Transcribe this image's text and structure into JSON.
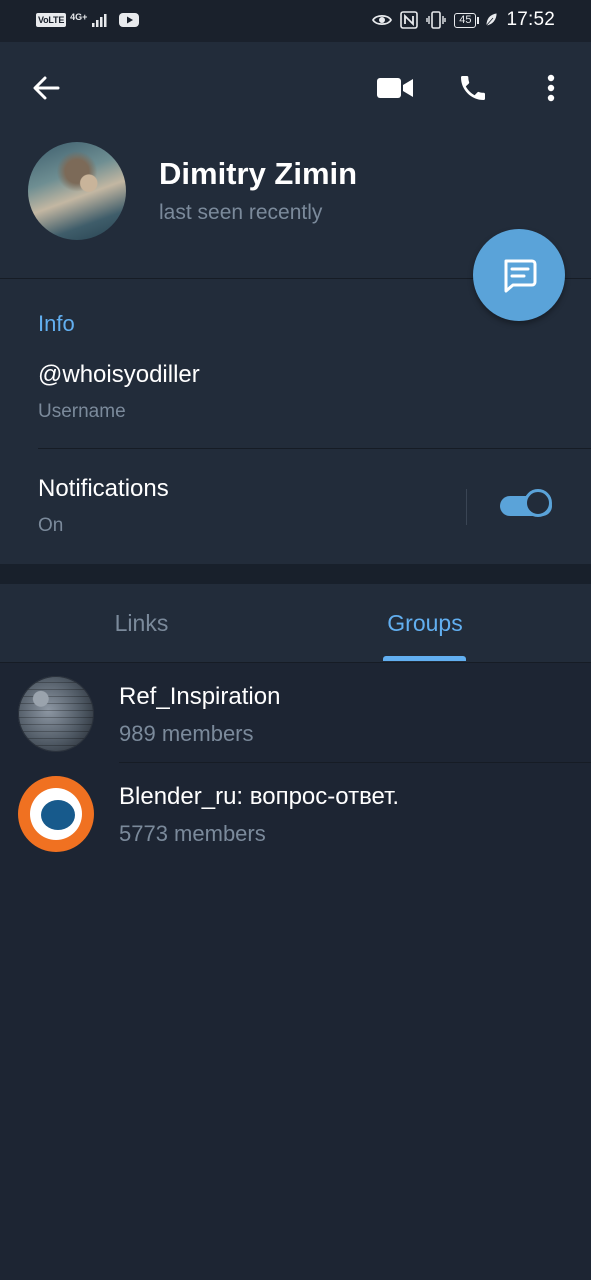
{
  "status_bar": {
    "left_badges": [
      "VoLTE",
      "4G+"
    ],
    "battery_level": "45",
    "time": "17:52",
    "icons": [
      "signal-icon",
      "youtube-icon",
      "eye-icon",
      "nfc-icon",
      "vibrate-icon",
      "battery-icon",
      "leaf-icon"
    ]
  },
  "header": {
    "back_icon": "arrow-left-icon",
    "actions": [
      "video-call-icon",
      "phone-call-icon",
      "more-vertical-icon"
    ],
    "name": "Dimitry Zimin",
    "status": "last seen recently"
  },
  "fab": {
    "icon": "message-icon"
  },
  "info": {
    "title": "Info",
    "username": "@whoisyodiller",
    "username_label": "Username",
    "notifications_label": "Notifications",
    "notifications_state": "On",
    "notifications_enabled": true
  },
  "tabs": [
    {
      "label": "Links",
      "active": false
    },
    {
      "label": "Groups",
      "active": true
    }
  ],
  "groups": [
    {
      "name": "Ref_Inspiration",
      "members": "989 members"
    },
    {
      "name": "Blender_ru: вопрос-ответ.",
      "members": "5773 members"
    }
  ],
  "colors": {
    "background": "#1d2533",
    "panel": "#222c3a",
    "accent": "#5aa3d9",
    "accent_text": "#62aff0",
    "secondary_text": "#7b8a9b"
  }
}
